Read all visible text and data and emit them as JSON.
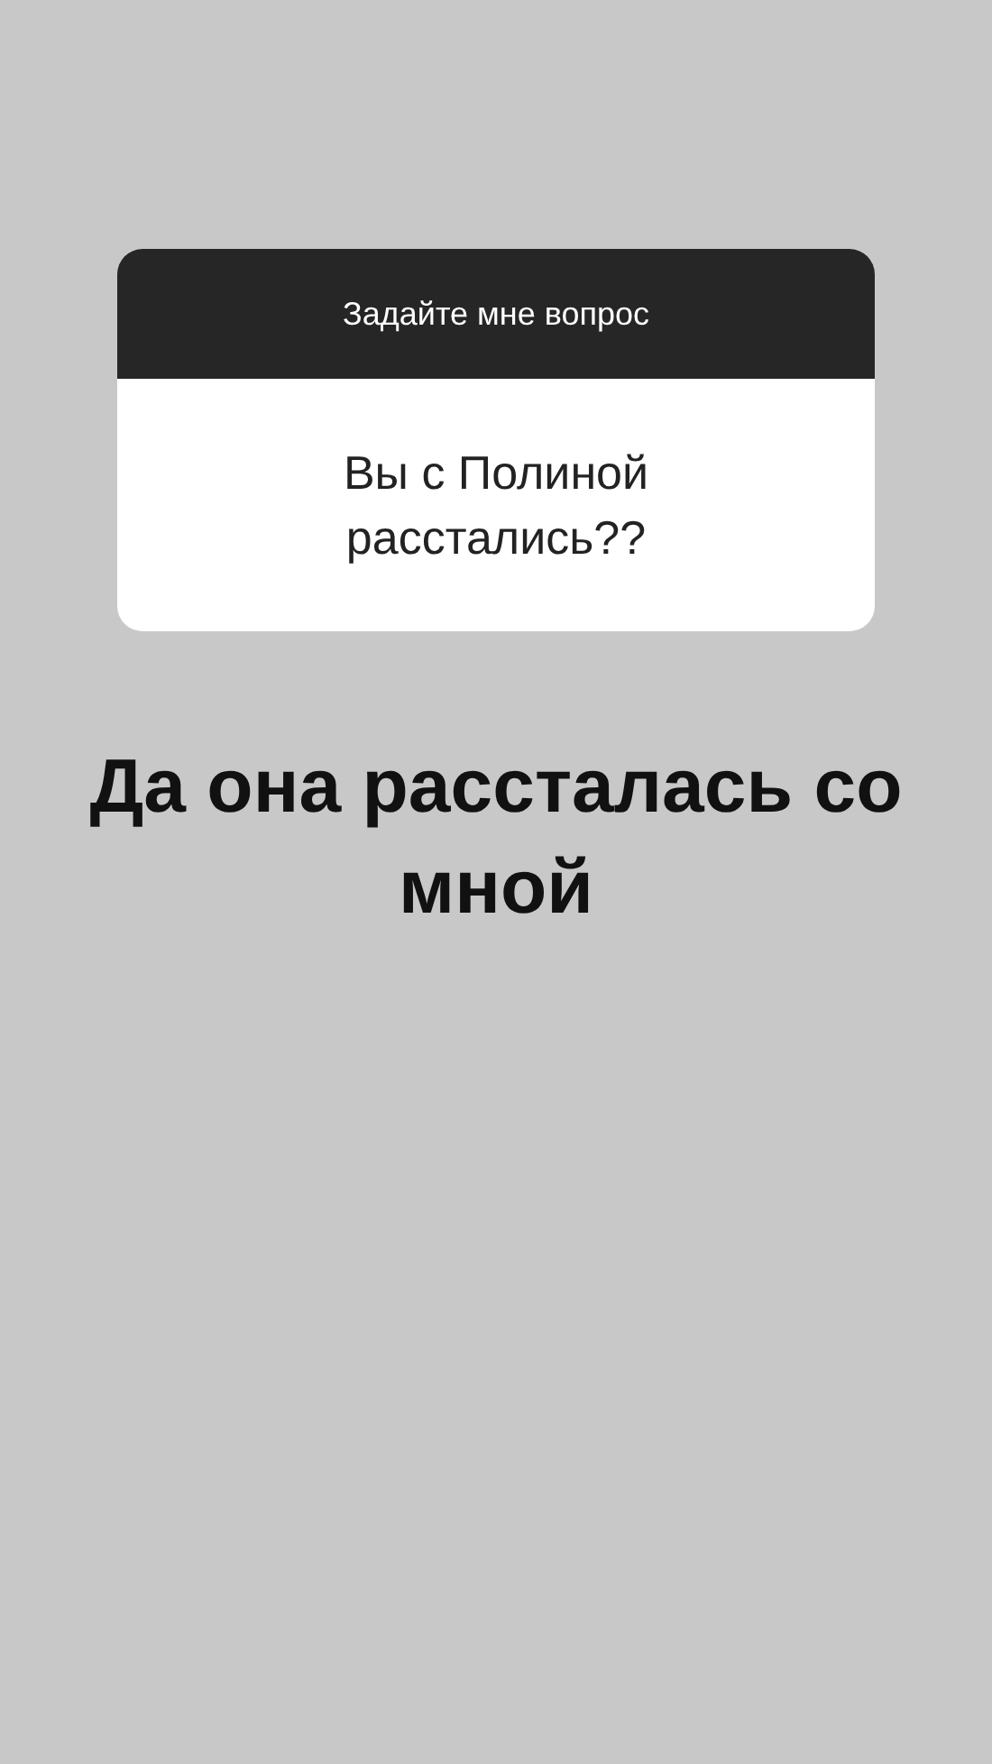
{
  "question_card": {
    "header": "Задайте мне вопрос",
    "question": "Вы с Полиной расстались??"
  },
  "answer": "Да она рассталась со мной"
}
